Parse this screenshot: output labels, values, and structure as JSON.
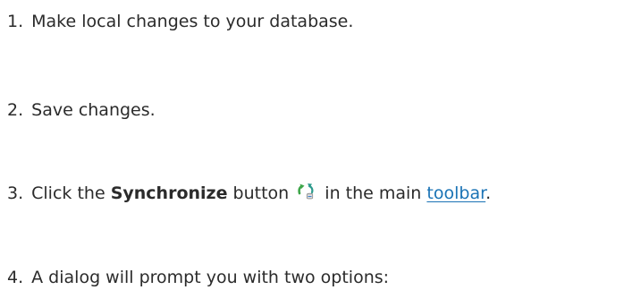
{
  "steps": [
    {
      "number": "1.",
      "text": "Make local changes to your database."
    },
    {
      "number": "2.",
      "text": "Save changes."
    },
    {
      "number": "3.",
      "before": "Click the",
      "bold": "Synchronize",
      "middle": "button",
      "after": "in the main",
      "link": "toolbar",
      "end": "."
    },
    {
      "number": "4.",
      "text": "A dialog will prompt you with two options:"
    }
  ],
  "icons": {
    "synchronize": "synchronize-icon"
  },
  "colors": {
    "text": "#2b2b2b",
    "link": "#1a73b5",
    "icon_green": "#3fa64a",
    "icon_teal": "#2c9a8c"
  }
}
